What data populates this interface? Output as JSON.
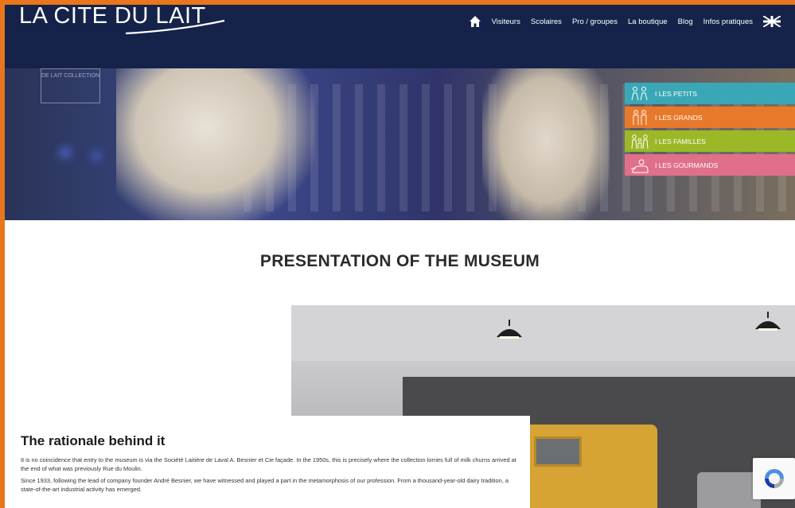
{
  "header": {
    "logo_text": "LA CITE DU LAIT",
    "nav": [
      {
        "label": "Visiteurs"
      },
      {
        "label": "Scolaires"
      },
      {
        "label": "Pro / groupes"
      },
      {
        "label": "La boutique"
      },
      {
        "label": "Blog"
      },
      {
        "label": "Infos pratiques"
      }
    ],
    "home_icon": "home-icon",
    "language_icon": "uk-flag-icon"
  },
  "hero": {
    "sign_text": "DE LAIT COLLECTION",
    "tabs": [
      {
        "label": "I LES PETITS",
        "color": "#3aa7b6",
        "icon": "children-icon"
      },
      {
        "label": "I LES GRANDS",
        "color": "#e8782a",
        "icon": "adults-icon"
      },
      {
        "label": "I LES FAMILLES",
        "color": "#9bb827",
        "icon": "family-icon"
      },
      {
        "label": "I LES GOURMANDS",
        "color": "#e0708a",
        "icon": "gourmet-icon"
      }
    ]
  },
  "main": {
    "title": "PRESENTATION OF THE MUSEUM",
    "section_heading": "The rationale behind it",
    "paragraphs": [
      "It is no coincidence that entry to the museum is via the Société Laitière de Laval A. Besnier et Cie façade. In the 1950s, this is precisely where the collection lorries full of milk churns arrived at the end of what was previously Rue du Moulin.",
      "Since 1933, following the lead of company founder André Besnier, we have witnessed and played a part in the metamorphosis of our profession. From a thousand-year-old dairy tradition, a state-of-the-art industrial activity has emerged."
    ]
  },
  "colors": {
    "header_bg": "#15234a",
    "frame_border": "#e8761c"
  }
}
